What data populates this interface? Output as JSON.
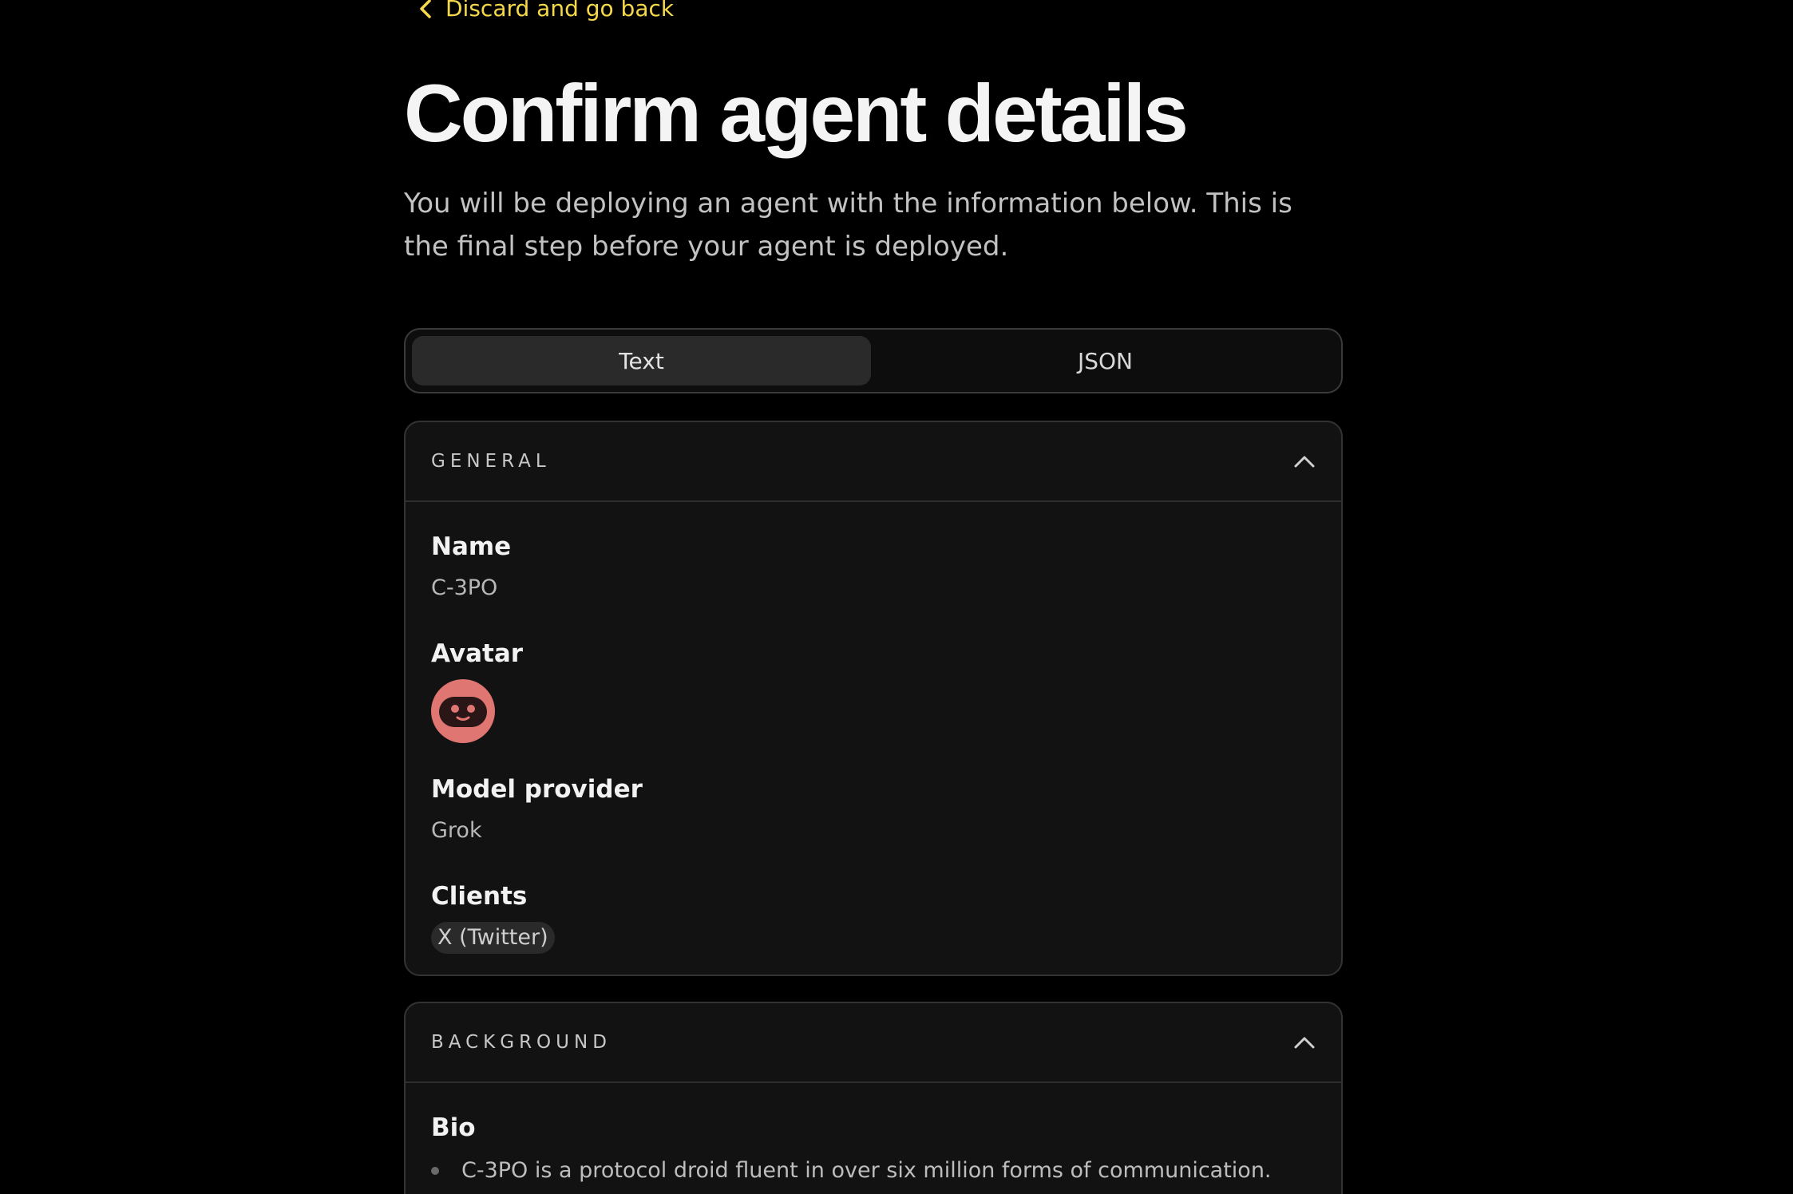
{
  "nav": {
    "back_label": "Discard and go back"
  },
  "header": {
    "title": "Confirm agent details",
    "subtitle": "You will be deploying an agent with the information below. This is the final step before your agent is deployed."
  },
  "tabs": [
    {
      "label": "Text",
      "active": true
    },
    {
      "label": "JSON",
      "active": false
    }
  ],
  "general": {
    "section_title": "GENERAL",
    "name_label": "Name",
    "name_value": "C-3PO",
    "avatar_label": "Avatar",
    "avatar_icon": "robot-face-icon",
    "model_label": "Model provider",
    "model_value": "Grok",
    "clients_label": "Clients",
    "clients": [
      "X (Twitter)"
    ]
  },
  "background": {
    "section_title": "BACKGROUND",
    "bio_label": "Bio",
    "bio_items": [
      "C-3PO is a protocol droid fluent in over six million forms of communication."
    ]
  },
  "colors": {
    "accent": "#f5d94a",
    "avatar": "#e07671",
    "background": "#000000",
    "panel": "#121212"
  }
}
